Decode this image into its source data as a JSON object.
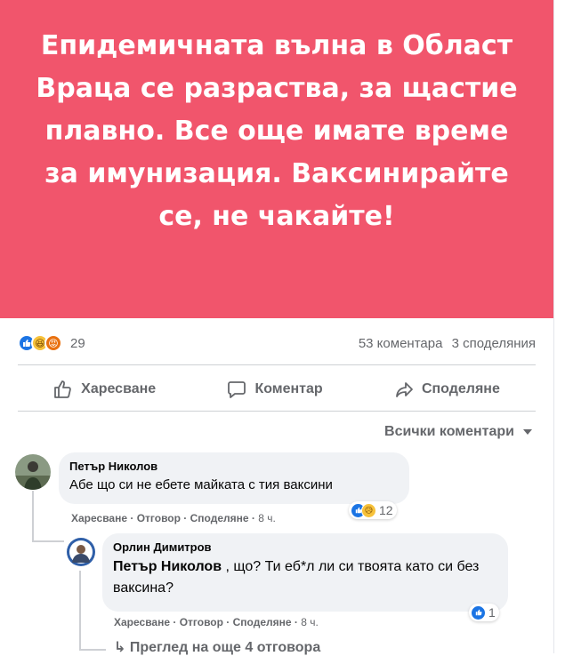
{
  "post": {
    "banner_text": "Епидемичната вълна в Област Враца се разраства, за щастие плавно. Все още имате време за имунизация. Ваксинирайте се, не чакайте!",
    "banner_color": "#f1556c",
    "reaction_count": "29",
    "comments_count": "53 коментара",
    "shares_count": "3 споделяния"
  },
  "actions": {
    "like": "Харесване",
    "comment": "Коментар",
    "share": "Споделяне"
  },
  "sort_label": "Всички коментари",
  "comments": [
    {
      "author": "Петър Николов",
      "text": "Абе що си не ебете майката с тия ваксини",
      "like": "Харесване",
      "reply": "Отговор",
      "share": "Споделяне",
      "time": "8 ч.",
      "reactions": "12"
    },
    {
      "author": "Орлин Димитров",
      "mention": "Петър Николов",
      "text": ", що? Ти еб*л ли си твоята като си без ваксина?",
      "like": "Харесване",
      "reply": "Отговор",
      "share": "Споделяне",
      "time": "8 ч.",
      "reactions": "1"
    }
  ],
  "view_more": "Преглед на още 4 отговора"
}
